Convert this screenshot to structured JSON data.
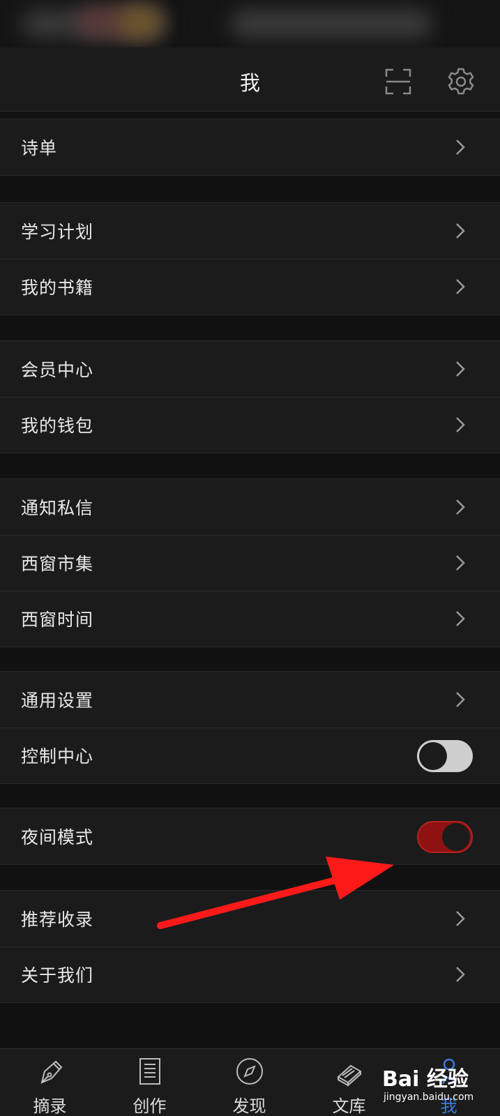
{
  "header": {
    "title": "我"
  },
  "sections": [
    {
      "items": [
        {
          "label": "诗单",
          "control": "chevron"
        }
      ]
    },
    {
      "items": [
        {
          "label": "学习计划",
          "control": "chevron"
        },
        {
          "label": "我的书籍",
          "control": "chevron"
        }
      ]
    },
    {
      "items": [
        {
          "label": "会员中心",
          "control": "chevron"
        },
        {
          "label": "我的钱包",
          "control": "chevron"
        }
      ]
    },
    {
      "items": [
        {
          "label": "通知私信",
          "control": "chevron"
        },
        {
          "label": "西窗市集",
          "control": "chevron"
        },
        {
          "label": "西窗时间",
          "control": "chevron"
        }
      ]
    },
    {
      "items": [
        {
          "label": "通用设置",
          "control": "chevron"
        },
        {
          "label": "控制中心",
          "control": "toggle",
          "on": false
        }
      ]
    },
    {
      "items": [
        {
          "label": "夜间模式",
          "control": "toggle",
          "on": true
        }
      ]
    },
    {
      "items": [
        {
          "label": "推荐收录",
          "control": "chevron"
        },
        {
          "label": "关于我们",
          "control": "chevron"
        }
      ]
    }
  ],
  "tabbar": {
    "tabs": [
      {
        "label": "摘录",
        "icon": "pen-nib-icon"
      },
      {
        "label": "创作",
        "icon": "document-icon"
      },
      {
        "label": "发现",
        "icon": "compass-icon"
      },
      {
        "label": "文库",
        "icon": "books-icon"
      },
      {
        "label": "我",
        "icon": "person-icon",
        "active": true
      }
    ]
  },
  "watermark": {
    "brand": "Bai 经验",
    "url": "jingyan.baidu.com"
  },
  "colors": {
    "toggle_on": "#8e1212",
    "toggle_off": "#cfcfcf",
    "active_tab": "#3b7be0",
    "annotation_arrow": "#ff1a1a"
  }
}
